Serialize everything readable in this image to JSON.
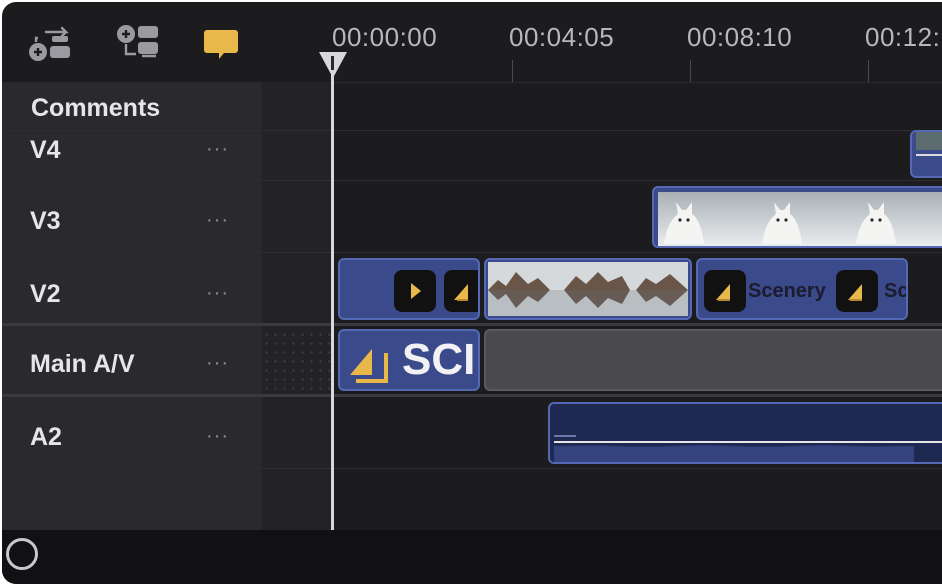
{
  "toolbar": {
    "icons": [
      "add-connected-clip-icon",
      "add-track-icon",
      "comment-icon"
    ],
    "colors": {
      "comment_accent": "#e8b94a"
    }
  },
  "ruler": {
    "timecodes": [
      "00:00:00",
      "00:04:05",
      "00:08:10",
      "00:12:"
    ]
  },
  "tracks": [
    {
      "label": "Comments",
      "more": ""
    },
    {
      "label": "V4",
      "more": "···"
    },
    {
      "label": "V3",
      "more": "···"
    },
    {
      "label": "V2",
      "more": "···"
    },
    {
      "label": "Main A/V",
      "more": "···"
    },
    {
      "label": "A2",
      "more": "···"
    }
  ],
  "clips": {
    "v2_title_clip": {
      "text": "Scenery",
      "text2": "Sc"
    },
    "main_title_clip": {
      "text": "SCI"
    }
  },
  "colors": {
    "clip_fill": "#3a4a8a",
    "clip_border": "#5568b4",
    "accent_yellow": "#e8b94a",
    "background": "#1c1c1e"
  }
}
